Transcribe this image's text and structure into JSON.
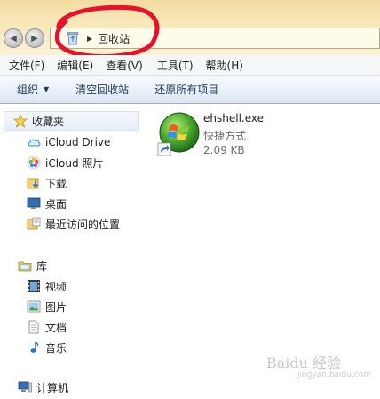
{
  "address_bar": {
    "path": "回收站"
  },
  "menu": {
    "file": "文件(F)",
    "edit": "编辑(E)",
    "view": "查看(V)",
    "tools": "工具(T)",
    "help": "帮助(H)"
  },
  "toolbar": {
    "organize": "组织",
    "empty_recycle_bin": "清空回收站",
    "restore_all": "还原所有项目"
  },
  "nav": {
    "favorites": "收藏夹",
    "favorites_items": [
      "iCloud Drive",
      "iCloud 照片",
      "下载",
      "桌面",
      "最近访问的位置"
    ],
    "libraries": "库",
    "library_items": [
      "视频",
      "图片",
      "文档",
      "音乐"
    ],
    "computer": "计算机"
  },
  "file": {
    "name": "ehshell.exe",
    "type": "快捷方式",
    "size": "2.09 KB"
  },
  "watermark": {
    "text": "Baidu 经验",
    "sub": "jingyan.baidu.com"
  },
  "colors": {
    "annotation": "#e8102a",
    "toolbar_text": "#1e395b",
    "address_bg": "#f7e7b9"
  }
}
